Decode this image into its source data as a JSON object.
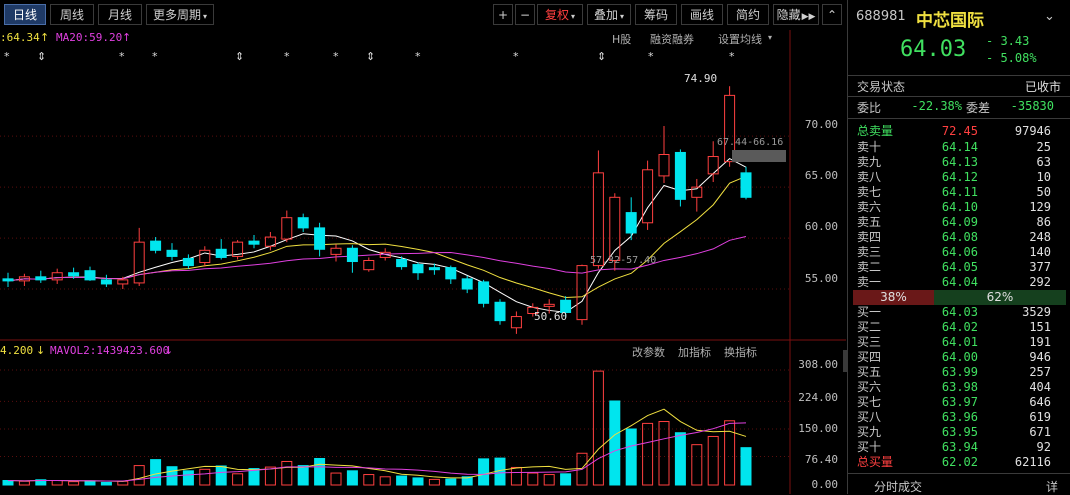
{
  "toolbar": {
    "periods": [
      "日线",
      "周线",
      "月线"
    ],
    "more_period": "更多周期",
    "plus": "+",
    "minus": "−",
    "fuquan": "复权",
    "overlay": "叠加",
    "chips": "筹码",
    "draw": "画线",
    "simple": "简约",
    "hide": "隐藏",
    "next": "▶▶",
    "scroll": "⌃"
  },
  "main_chart": {
    "ma_texts": [
      ":64.34",
      "MA20:59.20"
    ],
    "links": [
      "H股",
      "融资融券",
      "设置均线"
    ],
    "y_ticks": [
      "70.00",
      "65.00",
      "60.00",
      "55.00"
    ],
    "annotations": {
      "high": "74.90",
      "low": "50.60",
      "range1": "67.44-66.16",
      "range2": "57.32-57.40"
    }
  },
  "volume_chart": {
    "vol_texts": [
      "4.200",
      "MAVOL2:1439423.600"
    ],
    "links": [
      "改参数",
      "加指标",
      "换指标"
    ],
    "y_ticks": [
      "308.00",
      "224.00",
      "150.00",
      "76.40",
      "0.00"
    ]
  },
  "quote": {
    "code": "688981",
    "name": "中芯国际",
    "price": "64.03",
    "change": "- 3.43",
    "change_pct": "- 5.08%",
    "status_label": "交易状态",
    "status_value": "已收市",
    "weibi_label": "委比",
    "weibi_value": "-22.38%",
    "weicha_label": "委差",
    "weicha_value": "-35830",
    "total_sell_label": "总卖量",
    "total_sell_price": "72.45",
    "total_sell_vol": "97946",
    "sell": [
      {
        "label": "卖十",
        "price": "64.14",
        "vol": "25"
      },
      {
        "label": "卖九",
        "price": "64.13",
        "vol": "63"
      },
      {
        "label": "卖八",
        "price": "64.12",
        "vol": "10"
      },
      {
        "label": "卖七",
        "price": "64.11",
        "vol": "50"
      },
      {
        "label": "卖六",
        "price": "64.10",
        "vol": "129"
      },
      {
        "label": "卖五",
        "price": "64.09",
        "vol": "86"
      },
      {
        "label": "卖四",
        "price": "64.08",
        "vol": "248"
      },
      {
        "label": "卖三",
        "price": "64.06",
        "vol": "140"
      },
      {
        "label": "卖二",
        "price": "64.05",
        "vol": "377"
      },
      {
        "label": "卖一",
        "price": "64.04",
        "vol": "292"
      }
    ],
    "ratio_sell": "38%",
    "ratio_buy": "62%",
    "ratio_sell_frac": 0.38,
    "buy": [
      {
        "label": "买一",
        "price": "64.03",
        "vol": "3529"
      },
      {
        "label": "买二",
        "price": "64.02",
        "vol": "151"
      },
      {
        "label": "买三",
        "price": "64.01",
        "vol": "191"
      },
      {
        "label": "买四",
        "price": "64.00",
        "vol": "946"
      },
      {
        "label": "买五",
        "price": "63.99",
        "vol": "257"
      },
      {
        "label": "买六",
        "price": "63.98",
        "vol": "404"
      },
      {
        "label": "买七",
        "price": "63.97",
        "vol": "646"
      },
      {
        "label": "买八",
        "price": "63.96",
        "vol": "619"
      },
      {
        "label": "买九",
        "price": "63.95",
        "vol": "671"
      },
      {
        "label": "买十",
        "price": "63.94",
        "vol": "92"
      }
    ],
    "total_buy_label": "总买量",
    "total_buy_price": "62.02",
    "total_buy_vol": "62116",
    "bottom_tab": "分时成交",
    "bottom_right": "详"
  },
  "colors": {
    "up": "#ff4040",
    "down": "#00e5ee",
    "ma_white": "#ffffff",
    "ma_yellow": "#f0e040",
    "ma_magenta": "#e040e0",
    "green": "#40e060"
  },
  "chart_data": {
    "type": "candlestick",
    "ylim": [
      50,
      76
    ],
    "candles": [
      {
        "o": 56.0,
        "h": 56.6,
        "l": 55.2,
        "c": 55.8
      },
      {
        "o": 55.8,
        "h": 56.5,
        "l": 55.3,
        "c": 56.2
      },
      {
        "o": 56.2,
        "h": 56.8,
        "l": 55.6,
        "c": 55.9
      },
      {
        "o": 55.9,
        "h": 57.0,
        "l": 55.5,
        "c": 56.6
      },
      {
        "o": 56.6,
        "h": 57.1,
        "l": 56.0,
        "c": 56.3
      },
      {
        "o": 56.8,
        "h": 57.2,
        "l": 55.8,
        "c": 55.9
      },
      {
        "o": 55.9,
        "h": 56.4,
        "l": 55.2,
        "c": 55.5
      },
      {
        "o": 55.5,
        "h": 56.2,
        "l": 55.0,
        "c": 55.9
      },
      {
        "o": 55.6,
        "h": 61.0,
        "l": 55.3,
        "c": 59.6
      },
      {
        "o": 59.7,
        "h": 60.1,
        "l": 58.5,
        "c": 58.8
      },
      {
        "o": 58.8,
        "h": 59.5,
        "l": 57.8,
        "c": 58.2
      },
      {
        "o": 58.0,
        "h": 58.4,
        "l": 57.0,
        "c": 57.3
      },
      {
        "o": 57.6,
        "h": 59.2,
        "l": 57.2,
        "c": 58.8
      },
      {
        "o": 58.9,
        "h": 59.9,
        "l": 57.9,
        "c": 58.1
      },
      {
        "o": 58.2,
        "h": 59.8,
        "l": 57.9,
        "c": 59.6
      },
      {
        "o": 59.7,
        "h": 60.3,
        "l": 59.0,
        "c": 59.4
      },
      {
        "o": 59.2,
        "h": 60.6,
        "l": 58.8,
        "c": 60.1
      },
      {
        "o": 59.9,
        "h": 62.7,
        "l": 59.6,
        "c": 62.0
      },
      {
        "o": 62.0,
        "h": 62.4,
        "l": 60.6,
        "c": 61.0
      },
      {
        "o": 61.0,
        "h": 61.5,
        "l": 58.2,
        "c": 58.9
      },
      {
        "o": 58.4,
        "h": 59.4,
        "l": 57.7,
        "c": 59.0
      },
      {
        "o": 59.0,
        "h": 59.3,
        "l": 56.6,
        "c": 57.7
      },
      {
        "o": 56.9,
        "h": 58.1,
        "l": 56.7,
        "c": 57.8
      },
      {
        "o": 58.1,
        "h": 59.0,
        "l": 57.8,
        "c": 58.6
      },
      {
        "o": 57.9,
        "h": 58.2,
        "l": 56.9,
        "c": 57.2
      },
      {
        "o": 57.4,
        "h": 57.6,
        "l": 55.9,
        "c": 56.6
      },
      {
        "o": 57.1,
        "h": 57.5,
        "l": 56.4,
        "c": 56.9
      },
      {
        "o": 57.1,
        "h": 57.3,
        "l": 55.5,
        "c": 56.0
      },
      {
        "o": 56.0,
        "h": 56.3,
        "l": 54.6,
        "c": 55.0
      },
      {
        "o": 55.7,
        "h": 55.9,
        "l": 53.2,
        "c": 53.6
      },
      {
        "o": 53.7,
        "h": 54.0,
        "l": 51.5,
        "c": 51.9
      },
      {
        "o": 51.2,
        "h": 52.8,
        "l": 50.6,
        "c": 52.3
      },
      {
        "o": 52.6,
        "h": 53.6,
        "l": 52.3,
        "c": 53.2
      },
      {
        "o": 53.3,
        "h": 54.0,
        "l": 52.6,
        "c": 53.5
      },
      {
        "o": 53.9,
        "h": 54.3,
        "l": 52.2,
        "c": 52.7
      },
      {
        "o": 52.0,
        "h": 57.4,
        "l": 51.5,
        "c": 57.3
      },
      {
        "o": 57.3,
        "h": 68.6,
        "l": 57.0,
        "c": 66.4
      },
      {
        "o": 57.8,
        "h": 64.4,
        "l": 56.8,
        "c": 64.0
      },
      {
        "o": 62.5,
        "h": 64.0,
        "l": 59.8,
        "c": 60.5
      },
      {
        "o": 61.5,
        "h": 67.6,
        "l": 60.8,
        "c": 66.7
      },
      {
        "o": 66.1,
        "h": 71.0,
        "l": 65.4,
        "c": 68.2
      },
      {
        "o": 68.4,
        "h": 68.7,
        "l": 63.1,
        "c": 63.8
      },
      {
        "o": 64.0,
        "h": 65.8,
        "l": 62.6,
        "c": 65.0
      },
      {
        "o": 66.3,
        "h": 69.5,
        "l": 65.5,
        "c": 68.0
      },
      {
        "o": 67.5,
        "h": 74.9,
        "l": 67.0,
        "c": 74.0
      },
      {
        "o": 66.4,
        "h": 67.0,
        "l": 63.8,
        "c": 64.0
      }
    ],
    "volume": [
      {
        "v": 12,
        "up": false
      },
      {
        "v": 10,
        "up": true
      },
      {
        "v": 14,
        "up": false
      },
      {
        "v": 12,
        "up": true
      },
      {
        "v": 9,
        "up": true
      },
      {
        "v": 11,
        "up": false
      },
      {
        "v": 7,
        "up": false
      },
      {
        "v": 10,
        "up": true
      },
      {
        "v": 52,
        "up": true
      },
      {
        "v": 68,
        "up": false
      },
      {
        "v": 49,
        "up": false
      },
      {
        "v": 38,
        "up": false
      },
      {
        "v": 42,
        "up": true
      },
      {
        "v": 51,
        "up": false
      },
      {
        "v": 30,
        "up": true
      },
      {
        "v": 44,
        "up": false
      },
      {
        "v": 48,
        "up": true
      },
      {
        "v": 63,
        "up": true
      },
      {
        "v": 52,
        "up": false
      },
      {
        "v": 71,
        "up": false
      },
      {
        "v": 32,
        "up": true
      },
      {
        "v": 38,
        "up": false
      },
      {
        "v": 28,
        "up": true
      },
      {
        "v": 22,
        "up": true
      },
      {
        "v": 24,
        "up": false
      },
      {
        "v": 19,
        "up": false
      },
      {
        "v": 15,
        "up": true
      },
      {
        "v": 16,
        "up": false
      },
      {
        "v": 22,
        "up": false
      },
      {
        "v": 70,
        "up": false
      },
      {
        "v": 72,
        "up": false
      },
      {
        "v": 47,
        "up": true
      },
      {
        "v": 32,
        "up": true
      },
      {
        "v": 28,
        "up": true
      },
      {
        "v": 30,
        "up": false
      },
      {
        "v": 85,
        "up": true
      },
      {
        "v": 305,
        "up": true
      },
      {
        "v": 225,
        "up": false
      },
      {
        "v": 150,
        "up": false
      },
      {
        "v": 165,
        "up": true
      },
      {
        "v": 170,
        "up": true
      },
      {
        "v": 140,
        "up": false
      },
      {
        "v": 108,
        "up": true
      },
      {
        "v": 130,
        "up": true
      },
      {
        "v": 172,
        "up": true
      },
      {
        "v": 100,
        "up": false
      }
    ]
  }
}
